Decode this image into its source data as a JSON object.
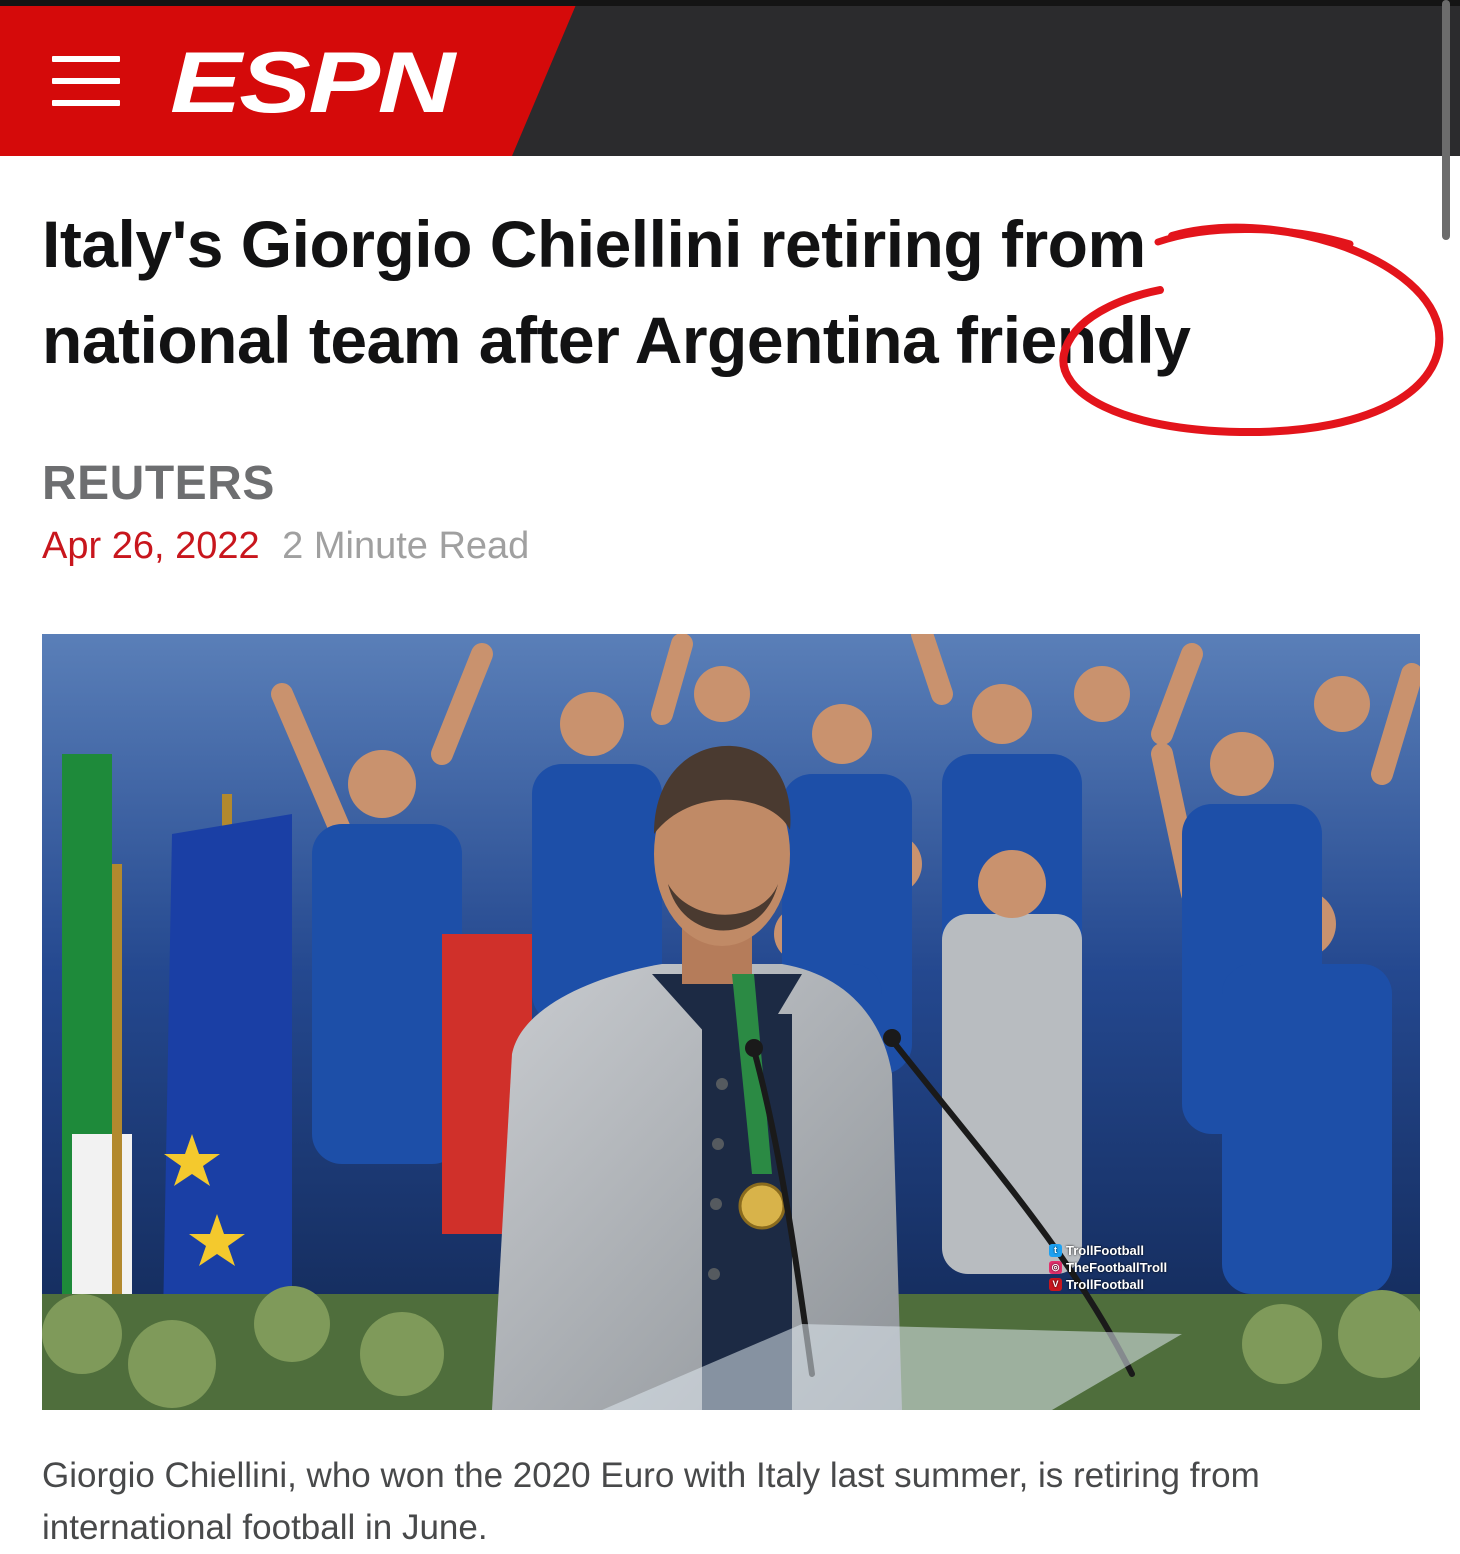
{
  "header": {
    "logo_text": "ESPN",
    "colors": {
      "brand_red": "#d50a0a",
      "bar_dark": "#2b2b2d"
    },
    "menu_icon": "hamburger-menu-icon"
  },
  "article": {
    "headline_line1": "Italy's Giorgio Chiellini retiring from",
    "headline_line2": "national team after Argentina friendly",
    "source": "REUTERS",
    "date": "Apr 26, 2022",
    "read_time": "2 Minute Read",
    "caption": "Giorgio Chiellini, who won the 2020 Euro with Italy last summer, is retiring from international football in June."
  },
  "photo": {
    "watermark": [
      {
        "icon": "twitter-icon",
        "text": "TrollFootball",
        "color": "#1da1f2"
      },
      {
        "icon": "instagram-icon",
        "text": "TheFootballTroll",
        "color": "#e1306c"
      },
      {
        "icon": "vk-icon",
        "text": "TrollFootball",
        "color": "#c8161d"
      }
    ]
  },
  "annotation": {
    "circle_color": "#e3141b"
  }
}
